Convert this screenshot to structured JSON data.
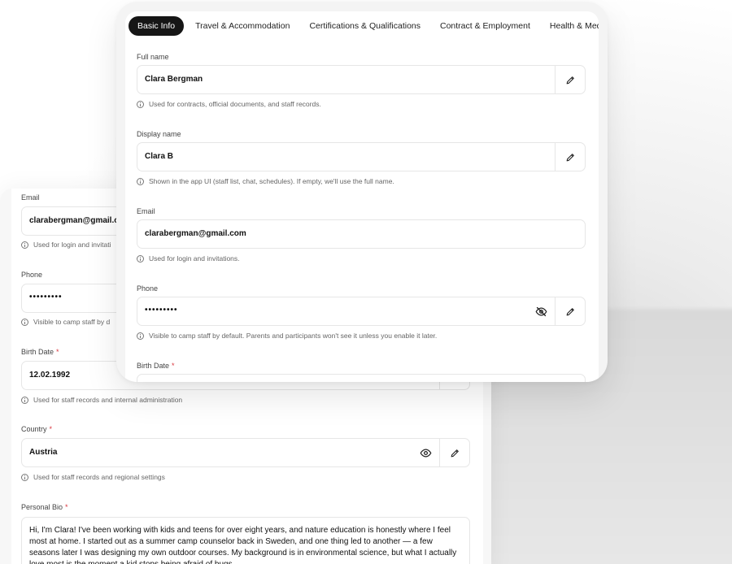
{
  "tabs": [
    {
      "label": "Basic Info",
      "active": true
    },
    {
      "label": "Travel & Accommodation",
      "active": false
    },
    {
      "label": "Certifications & Qualifications",
      "active": false
    },
    {
      "label": "Contract & Employment",
      "active": false
    },
    {
      "label": "Health & Medical",
      "active": false
    }
  ],
  "front": {
    "full_name": {
      "label": "Full name",
      "value": "Clara Bergman",
      "hint": "Used for contracts, official documents, and staff records."
    },
    "display_name": {
      "label": "Display name",
      "value": "Clara B",
      "hint": "Shown in the app UI (staff list, chat, schedules). If empty, we'll use the full name."
    },
    "email": {
      "label": "Email",
      "value": "clarabergman@gmail.com",
      "hint": "Used for login and invitations."
    },
    "phone": {
      "label": "Phone",
      "value": "•••••••••",
      "hint": "Visible to camp staff by default. Parents and participants won't see it unless you enable it later."
    },
    "birth_date": {
      "label": "Birth Date",
      "required": "*"
    }
  },
  "back": {
    "email": {
      "label": "Email",
      "value": "clarabergman@gmail.co",
      "hint": "Used for login and invitati"
    },
    "phone": {
      "label": "Phone",
      "value": "•••••••••",
      "hint": "Visible to camp staff by d"
    },
    "birth_date": {
      "label": "Birth Date",
      "required": "*",
      "value": "12.02.1992",
      "hint": "Used for staff records and internal administration"
    },
    "country": {
      "label": "Country",
      "required": "*",
      "value": "Austria",
      "hint": "Used for staff records and regional settings"
    },
    "bio": {
      "label": "Personal Bio",
      "required": "*",
      "value": "Hi, I'm Clara! I've been working with kids and teens for over eight years, and nature education is honestly where I feel most at home. I started out as a summer camp counselor back in Sweden, and one thing led to another — a few seasons later I was designing my own outdoor courses. My background is in environmental science, but what I actually love most is the moment a kid stops being afraid of bugs"
    }
  },
  "icons": {
    "edit": "pencil-icon",
    "eye": "eye-icon",
    "eye_off": "eye-off-icon",
    "info": "info-icon"
  }
}
